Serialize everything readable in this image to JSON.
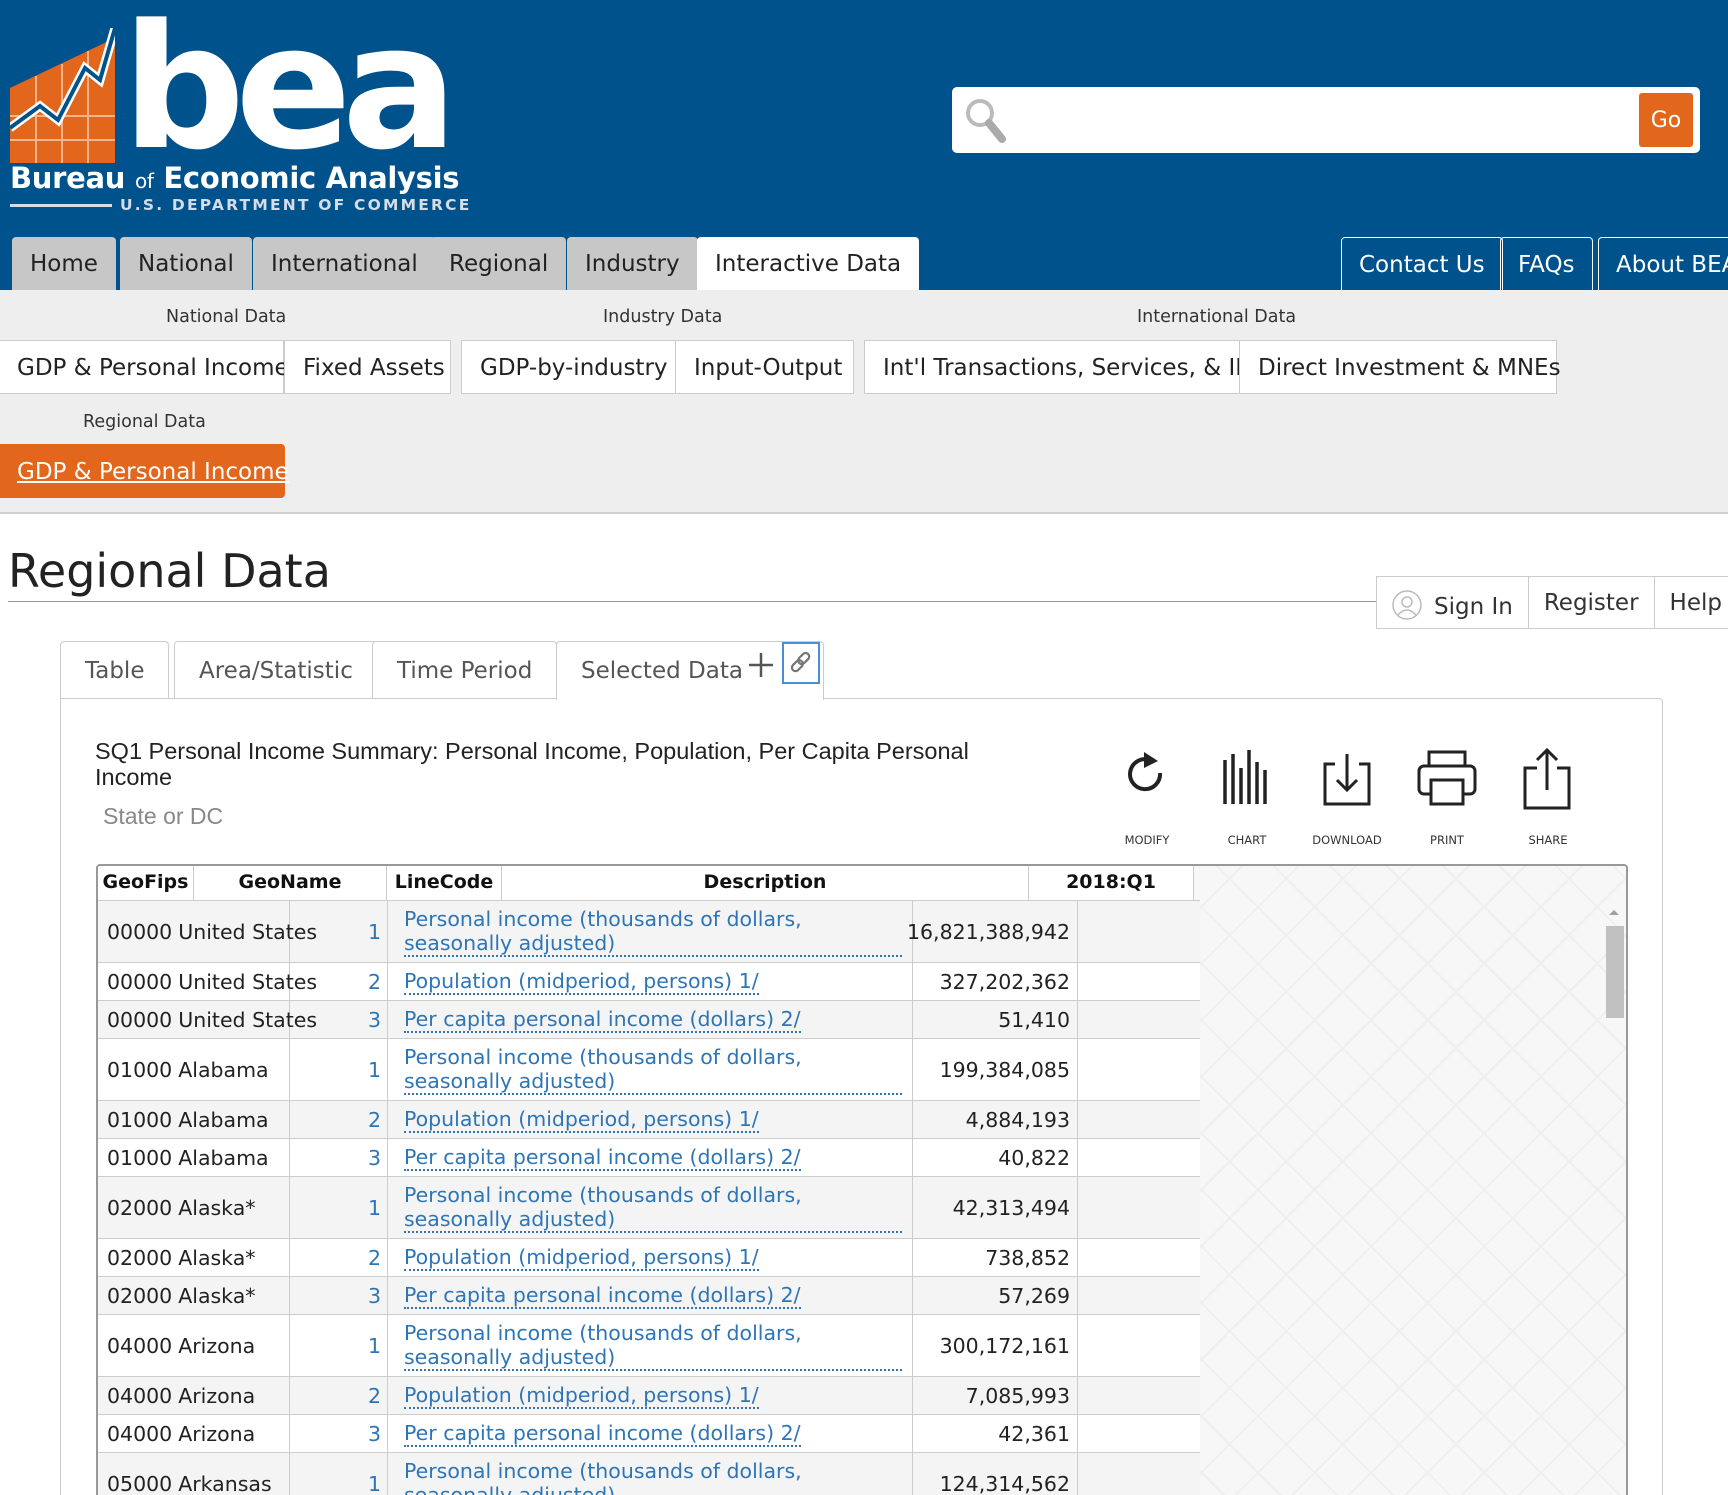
{
  "logo": {
    "word": "bea",
    "name_parts": [
      "Bureau ",
      "of",
      " Economic Analysis"
    ],
    "department": "U.S. DEPARTMENT OF COMMERCE",
    "colors": {
      "brand_blue": "#00528c",
      "brand_orange": "#e2661b"
    }
  },
  "search": {
    "placeholder": "",
    "value": "",
    "button_label": "Go",
    "icon": "search-icon"
  },
  "main_nav": {
    "tabs": [
      {
        "label": "Home"
      },
      {
        "label": "National"
      },
      {
        "label": "International"
      },
      {
        "label": "Regional"
      },
      {
        "label": "Industry"
      },
      {
        "label": "Interactive Data",
        "active": true
      }
    ],
    "utility": [
      {
        "label": "Contact Us"
      },
      {
        "label": "FAQs"
      },
      {
        "label": "About BEA"
      }
    ]
  },
  "subnav": {
    "groups": [
      {
        "label": "National Data",
        "items": [
          "GDP & Personal Income",
          "Fixed Assets"
        ]
      },
      {
        "label": "Industry Data",
        "items": [
          "GDP-by-industry",
          "Input-Output"
        ]
      },
      {
        "label": "International Data",
        "items": [
          "Int'l Transactions, Services, & IIP",
          "Direct Investment & MNEs"
        ]
      },
      {
        "label": "Regional Data",
        "items": [
          "GDP & Personal Income"
        ],
        "active_index": 0
      }
    ]
  },
  "page": {
    "title": "Regional Data"
  },
  "auth": {
    "sign_in": "Sign In",
    "register": "Register",
    "help": "Help",
    "icon": "user-icon"
  },
  "data_tabs": [
    {
      "label": "Table"
    },
    {
      "label": "Area/Statistic"
    },
    {
      "label": "Time Period"
    },
    {
      "label": "Selected Data",
      "active": true
    }
  ],
  "table_meta": {
    "title": "SQ1 Personal Income Summary: Personal Income, Population, Per Capita Personal Income",
    "subtitle": "State or DC"
  },
  "toolbar": [
    {
      "label": "MODIFY",
      "icon": "refresh-icon"
    },
    {
      "label": "CHART",
      "icon": "chart-icon"
    },
    {
      "label": "DOWNLOAD",
      "icon": "download-icon"
    },
    {
      "label": "PRINT",
      "icon": "print-icon"
    },
    {
      "label": "SHARE",
      "icon": "share-icon"
    }
  ],
  "grid": {
    "columns": [
      "GeoFips",
      "GeoName",
      "LineCode",
      "Description",
      "2018:Q1"
    ],
    "rows": [
      {
        "fips": "00000",
        "name": "United States",
        "line": "1",
        "desc": "Personal income (thousands of dollars, seasonally adjusted)",
        "value": "16,821,388,942"
      },
      {
        "fips": "00000",
        "name": "United States",
        "line": "2",
        "desc": "Population (midperiod, persons) 1/",
        "value": "327,202,362"
      },
      {
        "fips": "00000",
        "name": "United States",
        "line": "3",
        "desc": "Per capita personal income (dollars) 2/",
        "value": "51,410"
      },
      {
        "fips": "01000",
        "name": "Alabama",
        "line": "1",
        "desc": "Personal income (thousands of dollars, seasonally adjusted)",
        "value": "199,384,085"
      },
      {
        "fips": "01000",
        "name": "Alabama",
        "line": "2",
        "desc": "Population (midperiod, persons) 1/",
        "value": "4,884,193"
      },
      {
        "fips": "01000",
        "name": "Alabama",
        "line": "3",
        "desc": "Per capita personal income (dollars) 2/",
        "value": "40,822"
      },
      {
        "fips": "02000",
        "name": "Alaska*",
        "line": "1",
        "desc": "Personal income (thousands of dollars, seasonally adjusted)",
        "value": "42,313,494"
      },
      {
        "fips": "02000",
        "name": "Alaska*",
        "line": "2",
        "desc": "Population (midperiod, persons) 1/",
        "value": "738,852"
      },
      {
        "fips": "02000",
        "name": "Alaska*",
        "line": "3",
        "desc": "Per capita personal income (dollars) 2/",
        "value": "57,269"
      },
      {
        "fips": "04000",
        "name": "Arizona",
        "line": "1",
        "desc": "Personal income (thousands of dollars, seasonally adjusted)",
        "value": "300,172,161"
      },
      {
        "fips": "04000",
        "name": "Arizona",
        "line": "2",
        "desc": "Population (midperiod, persons) 1/",
        "value": "7,085,993"
      },
      {
        "fips": "04000",
        "name": "Arizona",
        "line": "3",
        "desc": "Per capita personal income (dollars) 2/",
        "value": "42,361"
      },
      {
        "fips": "05000",
        "name": "Arkansas",
        "line": "1",
        "desc": "Personal income (thousands of dollars, seasonally adjusted)",
        "value": "124,314,562"
      }
    ]
  }
}
